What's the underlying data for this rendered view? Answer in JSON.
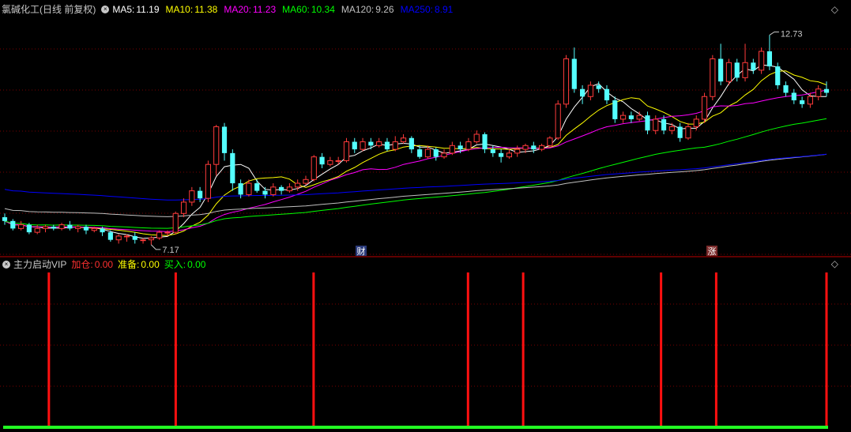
{
  "main_header": {
    "stock_name": "氯碱化工",
    "period": "(日线 前复权)",
    "ma": [
      {
        "label": "MA5:",
        "value": "11.19",
        "color": "#ffffff"
      },
      {
        "label": "MA10:",
        "value": "11.38",
        "color": "#ffff00"
      },
      {
        "label": "MA20:",
        "value": "11.23",
        "color": "#ff00ff"
      },
      {
        "label": "MA60:",
        "value": "10.34",
        "color": "#00ff00"
      },
      {
        "label": "MA120:",
        "value": "9.26",
        "color": "#c0c0c0"
      },
      {
        "label": "MA250:",
        "value": "8.91",
        "color": "#0000ff"
      }
    ]
  },
  "indicator_header": {
    "name": "主力启动VIP",
    "items": [
      {
        "label": "加仓:",
        "value": "0.00",
        "color": "#ff3030"
      },
      {
        "label": "准备:",
        "value": "0.00",
        "color": "#ffff00"
      },
      {
        "label": "买入:",
        "value": "0.00",
        "color": "#00ff00"
      }
    ]
  },
  "icons": {
    "close": "close-icon",
    "diamond": "diamond-icon"
  },
  "chart_data": [
    {
      "type": "candlestick",
      "title": "氯碱化工 (日线 前复权)",
      "price_range": [
        7.0,
        13.2
      ],
      "annotations": {
        "high": "12.73",
        "low": "7.17",
        "markers": [
          "财",
          "涨"
        ]
      },
      "candles": [
        [
          7.9,
          7.8,
          8.0,
          7.7
        ],
        [
          7.8,
          7.6,
          7.85,
          7.55
        ],
        [
          7.6,
          7.7,
          7.8,
          7.55
        ],
        [
          7.7,
          7.5,
          7.75,
          7.45
        ],
        [
          7.5,
          7.6,
          7.7,
          7.45
        ],
        [
          7.6,
          7.65,
          7.7,
          7.5
        ],
        [
          7.65,
          7.6,
          7.7,
          7.55
        ],
        [
          7.6,
          7.7,
          7.75,
          7.55
        ],
        [
          7.7,
          7.6,
          7.8,
          7.55
        ],
        [
          7.6,
          7.65,
          7.7,
          7.5
        ],
        [
          7.65,
          7.55,
          7.7,
          7.45
        ],
        [
          7.55,
          7.6,
          7.65,
          7.5
        ],
        [
          7.6,
          7.5,
          7.65,
          7.4
        ],
        [
          7.5,
          7.3,
          7.55,
          7.25
        ],
        [
          7.3,
          7.4,
          7.45,
          7.2
        ],
        [
          7.4,
          7.4,
          7.45,
          7.25
        ],
        [
          7.4,
          7.3,
          7.5,
          7.2
        ],
        [
          7.3,
          7.3,
          7.35,
          7.2
        ],
        [
          7.3,
          7.35,
          7.4,
          7.17
        ],
        [
          7.35,
          7.5,
          7.55,
          7.3
        ],
        [
          7.5,
          7.5,
          7.55,
          7.4
        ],
        [
          7.5,
          8.0,
          8.05,
          7.45
        ],
        [
          8.0,
          8.3,
          8.4,
          7.9
        ],
        [
          8.3,
          8.6,
          8.7,
          8.2
        ],
        [
          8.6,
          8.4,
          8.7,
          8.3
        ],
        [
          8.4,
          9.3,
          9.4,
          8.3
        ],
        [
          9.3,
          10.3,
          10.35,
          9.0
        ],
        [
          10.3,
          9.6,
          10.4,
          9.4
        ],
        [
          9.6,
          8.8,
          9.7,
          8.6
        ],
        [
          8.8,
          8.5,
          8.9,
          8.4
        ],
        [
          8.5,
          8.8,
          8.9,
          8.45
        ],
        [
          8.8,
          8.6,
          8.9,
          8.55
        ],
        [
          8.6,
          8.5,
          8.7,
          8.4
        ],
        [
          8.5,
          8.7,
          8.8,
          8.45
        ],
        [
          8.7,
          8.6,
          8.75,
          8.5
        ],
        [
          8.6,
          8.7,
          8.8,
          8.55
        ],
        [
          8.7,
          8.8,
          8.9,
          8.6
        ],
        [
          8.8,
          8.9,
          9.0,
          8.75
        ],
        [
          8.9,
          9.5,
          9.55,
          8.85
        ],
        [
          9.5,
          9.3,
          9.6,
          9.2
        ],
        [
          9.3,
          9.4,
          9.5,
          9.25
        ],
        [
          9.4,
          9.4,
          9.5,
          9.3
        ],
        [
          9.4,
          9.9,
          10.0,
          9.35
        ],
        [
          9.9,
          9.7,
          10.0,
          9.6
        ],
        [
          9.7,
          9.9,
          10.0,
          9.65
        ],
        [
          9.9,
          9.8,
          10.0,
          9.7
        ],
        [
          9.8,
          9.9,
          10.0,
          9.75
        ],
        [
          9.9,
          9.7,
          10.0,
          9.65
        ],
        [
          9.7,
          9.9,
          10.05,
          9.65
        ],
        [
          9.9,
          10.0,
          10.1,
          9.85
        ],
        [
          10.0,
          9.7,
          10.05,
          9.6
        ],
        [
          9.7,
          9.5,
          9.8,
          9.45
        ],
        [
          9.5,
          9.7,
          9.8,
          9.45
        ],
        [
          9.7,
          9.5,
          9.75,
          9.4
        ],
        [
          9.5,
          9.6,
          9.7,
          9.45
        ],
        [
          9.6,
          9.8,
          9.9,
          9.55
        ],
        [
          9.8,
          9.7,
          9.9,
          9.6
        ],
        [
          9.7,
          9.9,
          10.0,
          9.65
        ],
        [
          9.9,
          10.1,
          10.2,
          9.85
        ],
        [
          10.1,
          9.7,
          10.15,
          9.6
        ],
        [
          9.7,
          9.6,
          9.8,
          9.5
        ],
        [
          9.6,
          9.5,
          9.7,
          9.35
        ],
        [
          9.5,
          9.6,
          9.7,
          9.45
        ],
        [
          9.6,
          9.7,
          9.8,
          9.5
        ],
        [
          9.7,
          9.8,
          9.85,
          9.6
        ],
        [
          9.8,
          9.7,
          9.9,
          9.6
        ],
        [
          9.7,
          9.8,
          9.85,
          9.65
        ],
        [
          9.8,
          10.0,
          10.05,
          9.75
        ],
        [
          10.0,
          10.9,
          11.0,
          9.95
        ],
        [
          10.9,
          12.1,
          12.2,
          10.8
        ],
        [
          12.1,
          11.3,
          12.4,
          11.2
        ],
        [
          11.3,
          11.1,
          11.4,
          10.9
        ],
        [
          11.1,
          11.4,
          11.5,
          11.0
        ],
        [
          11.4,
          11.3,
          11.5,
          11.2
        ],
        [
          11.3,
          11.0,
          11.4,
          10.9
        ],
        [
          11.0,
          10.5,
          11.1,
          10.4
        ],
        [
          10.5,
          10.6,
          10.7,
          10.4
        ],
        [
          10.6,
          10.5,
          10.7,
          10.4
        ],
        [
          10.5,
          10.6,
          10.7,
          10.45
        ],
        [
          10.6,
          10.2,
          10.7,
          10.1
        ],
        [
          10.2,
          10.5,
          10.6,
          10.1
        ],
        [
          10.5,
          10.2,
          10.6,
          10.1
        ],
        [
          10.2,
          10.3,
          10.4,
          10.1
        ],
        [
          10.3,
          10.0,
          10.4,
          9.9
        ],
        [
          10.0,
          10.3,
          10.4,
          9.95
        ],
        [
          10.3,
          10.5,
          10.6,
          10.2
        ],
        [
          10.5,
          11.1,
          11.2,
          10.4
        ],
        [
          11.1,
          12.1,
          12.2,
          11.0
        ],
        [
          12.1,
          11.5,
          12.5,
          11.4
        ],
        [
          11.5,
          12.0,
          12.1,
          11.4
        ],
        [
          12.0,
          11.6,
          12.1,
          11.5
        ],
        [
          11.6,
          12.0,
          12.5,
          11.5
        ],
        [
          12.0,
          11.8,
          12.1,
          11.7
        ],
        [
          11.8,
          12.3,
          12.4,
          11.7
        ],
        [
          12.3,
          11.9,
          12.73,
          11.8
        ],
        [
          11.9,
          11.4,
          12.0,
          11.3
        ],
        [
          11.4,
          11.2,
          11.5,
          11.1
        ],
        [
          11.2,
          11.0,
          11.3,
          10.9
        ],
        [
          11.0,
          10.9,
          11.1,
          10.8
        ],
        [
          10.9,
          11.1,
          11.2,
          10.8
        ],
        [
          11.1,
          11.3,
          11.4,
          11.0
        ],
        [
          11.3,
          11.2,
          11.5,
          11.1
        ]
      ]
    },
    {
      "type": "bar",
      "title": "主力启动VIP",
      "signal_indices": [
        8,
        31,
        56,
        84,
        94,
        119,
        129,
        149
      ],
      "signal_count": 150
    }
  ]
}
